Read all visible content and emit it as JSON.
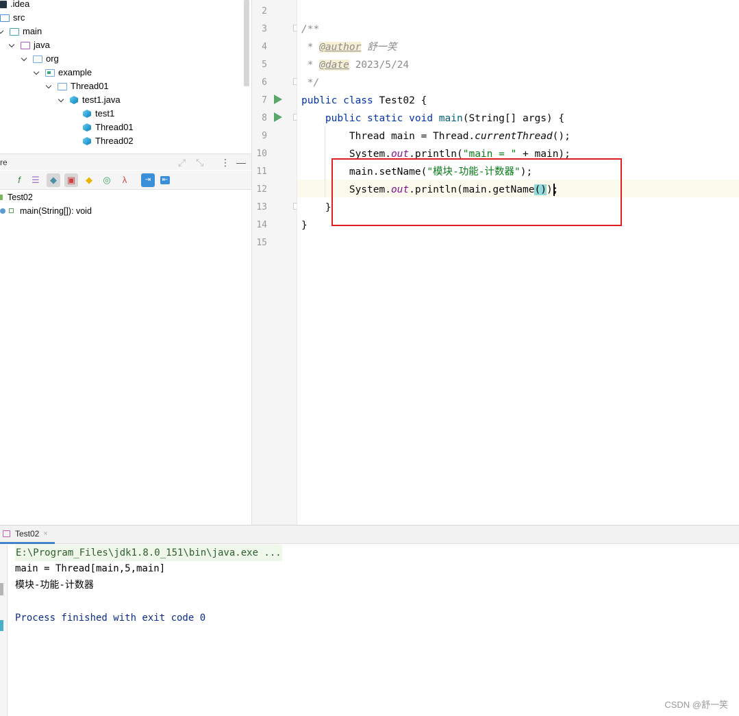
{
  "project_tree": {
    "items": [
      {
        "label": ".idea"
      },
      {
        "label": "src"
      },
      {
        "label": "main"
      },
      {
        "label": "java"
      },
      {
        "label": "org"
      },
      {
        "label": "example"
      },
      {
        "label": "Thread01"
      },
      {
        "label": "test1.java"
      },
      {
        "label": "test1"
      },
      {
        "label": "Thread01"
      },
      {
        "label": "Thread02"
      }
    ]
  },
  "structure": {
    "title": "re",
    "class_name": "Test02",
    "method": "main(String[]): void"
  },
  "editor": {
    "line_numbers": [
      "2",
      "3",
      "4",
      "5",
      "6",
      "7",
      "8",
      "9",
      "10",
      "11",
      "12",
      "13",
      "14",
      "15"
    ],
    "author": "舒一笑",
    "date": "2023/5/24",
    "class_name": "Test02",
    "string_main": "\"main = \"",
    "string_name": "\"模块-功能-计数器\""
  },
  "run_panel": {
    "tab_label": "Test02",
    "tab_close": "×",
    "console": {
      "command": "E:\\Program_Files\\jdk1.8.0_151\\bin\\java.exe ...",
      "output1": "main = Thread[main,5,main]",
      "output2": "模块-功能-计数器",
      "exit": "Process finished with exit code 0"
    }
  },
  "watermark": "CSDN @舒一笑",
  "colors": {
    "keyword": "#0033b3",
    "string": "#067d17",
    "comment": "#8c8c8c",
    "annotation_box": "#e02020",
    "run_icon": "#59a869"
  }
}
